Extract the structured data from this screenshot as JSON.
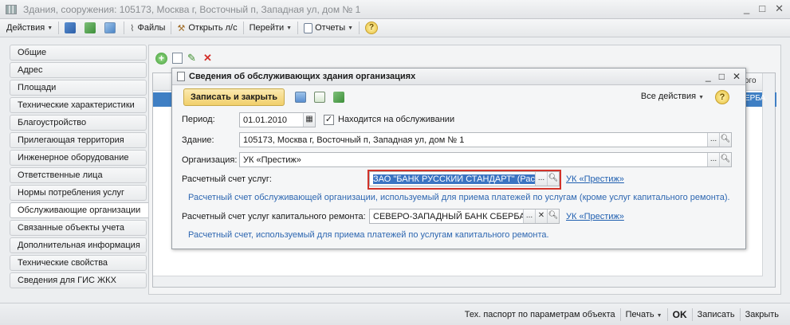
{
  "window": {
    "title": "Здания, сооружения: 105173, Москва г, Восточный п, Западная ул, дом № 1",
    "controls": [
      "_",
      "□",
      "✕"
    ]
  },
  "toolbar": {
    "actions": "Действия",
    "files": "Файлы",
    "open_account": "Открыть л/с",
    "go_to": "Перейти",
    "reports": "Отчеты",
    "help": "?"
  },
  "sidebar": {
    "items": [
      {
        "label": "Общие"
      },
      {
        "label": "Адрес"
      },
      {
        "label": "Площади"
      },
      {
        "label": "Технические характеристики"
      },
      {
        "label": "Благоустройство"
      },
      {
        "label": "Прилегающая территория"
      },
      {
        "label": "Инженерное оборудование"
      },
      {
        "label": "Ответственные лица"
      },
      {
        "label": "Нормы потребления услуг"
      },
      {
        "label": "Обслуживающие организации"
      },
      {
        "label": "Связанные объекты учета"
      },
      {
        "label": "Дополнительная информация"
      },
      {
        "label": "Технические свойства"
      },
      {
        "label": "Сведения для ГИС ЖКХ"
      }
    ],
    "active_index": 9
  },
  "grid": {
    "header_peek": "ого",
    "row_peek": "ЕРБА"
  },
  "dialog": {
    "title": "Сведения об обслуживающих здания организациях",
    "controls": [
      "_",
      "□",
      "✕"
    ],
    "save_close": "Записать и закрыть",
    "all_actions": "Все действия",
    "help": "?",
    "period_label": "Период:",
    "period_value": "01.01.2010",
    "serviced_checked": true,
    "serviced_label": "Находится на обслуживании",
    "building_label": "Здание:",
    "building_value": "105173, Москва г, Восточный п, Западная ул, дом № 1",
    "org_label": "Организация:",
    "org_value": "УК «Престиж»",
    "account_label": "Расчетный счет услуг:",
    "account_value": "ЗАО \"БАНК РУССКИЙ СТАНДАРТ\" (Рас",
    "account_link": "УК «Престиж»",
    "account_hint": "Расчетный счет обслуживающей организации, используемый для приема платежей по услугам (кроме услуг капитального ремонта).",
    "capital_label": "Расчетный счет услуг капитального ремонта:",
    "capital_value": "СЕВЕРО-ЗАПАДНЫЙ БАНК СБЕРБАІ",
    "capital_link": "УК «Престиж»",
    "capital_hint": "Расчетный счет, используемый для приема платежей по услугам капитального ремонта."
  },
  "statusbar": {
    "tech_passport": "Тех. паспорт по параметрам объекта",
    "print": "Печать",
    "ok": "OK",
    "save": "Записать",
    "close": "Закрыть"
  }
}
